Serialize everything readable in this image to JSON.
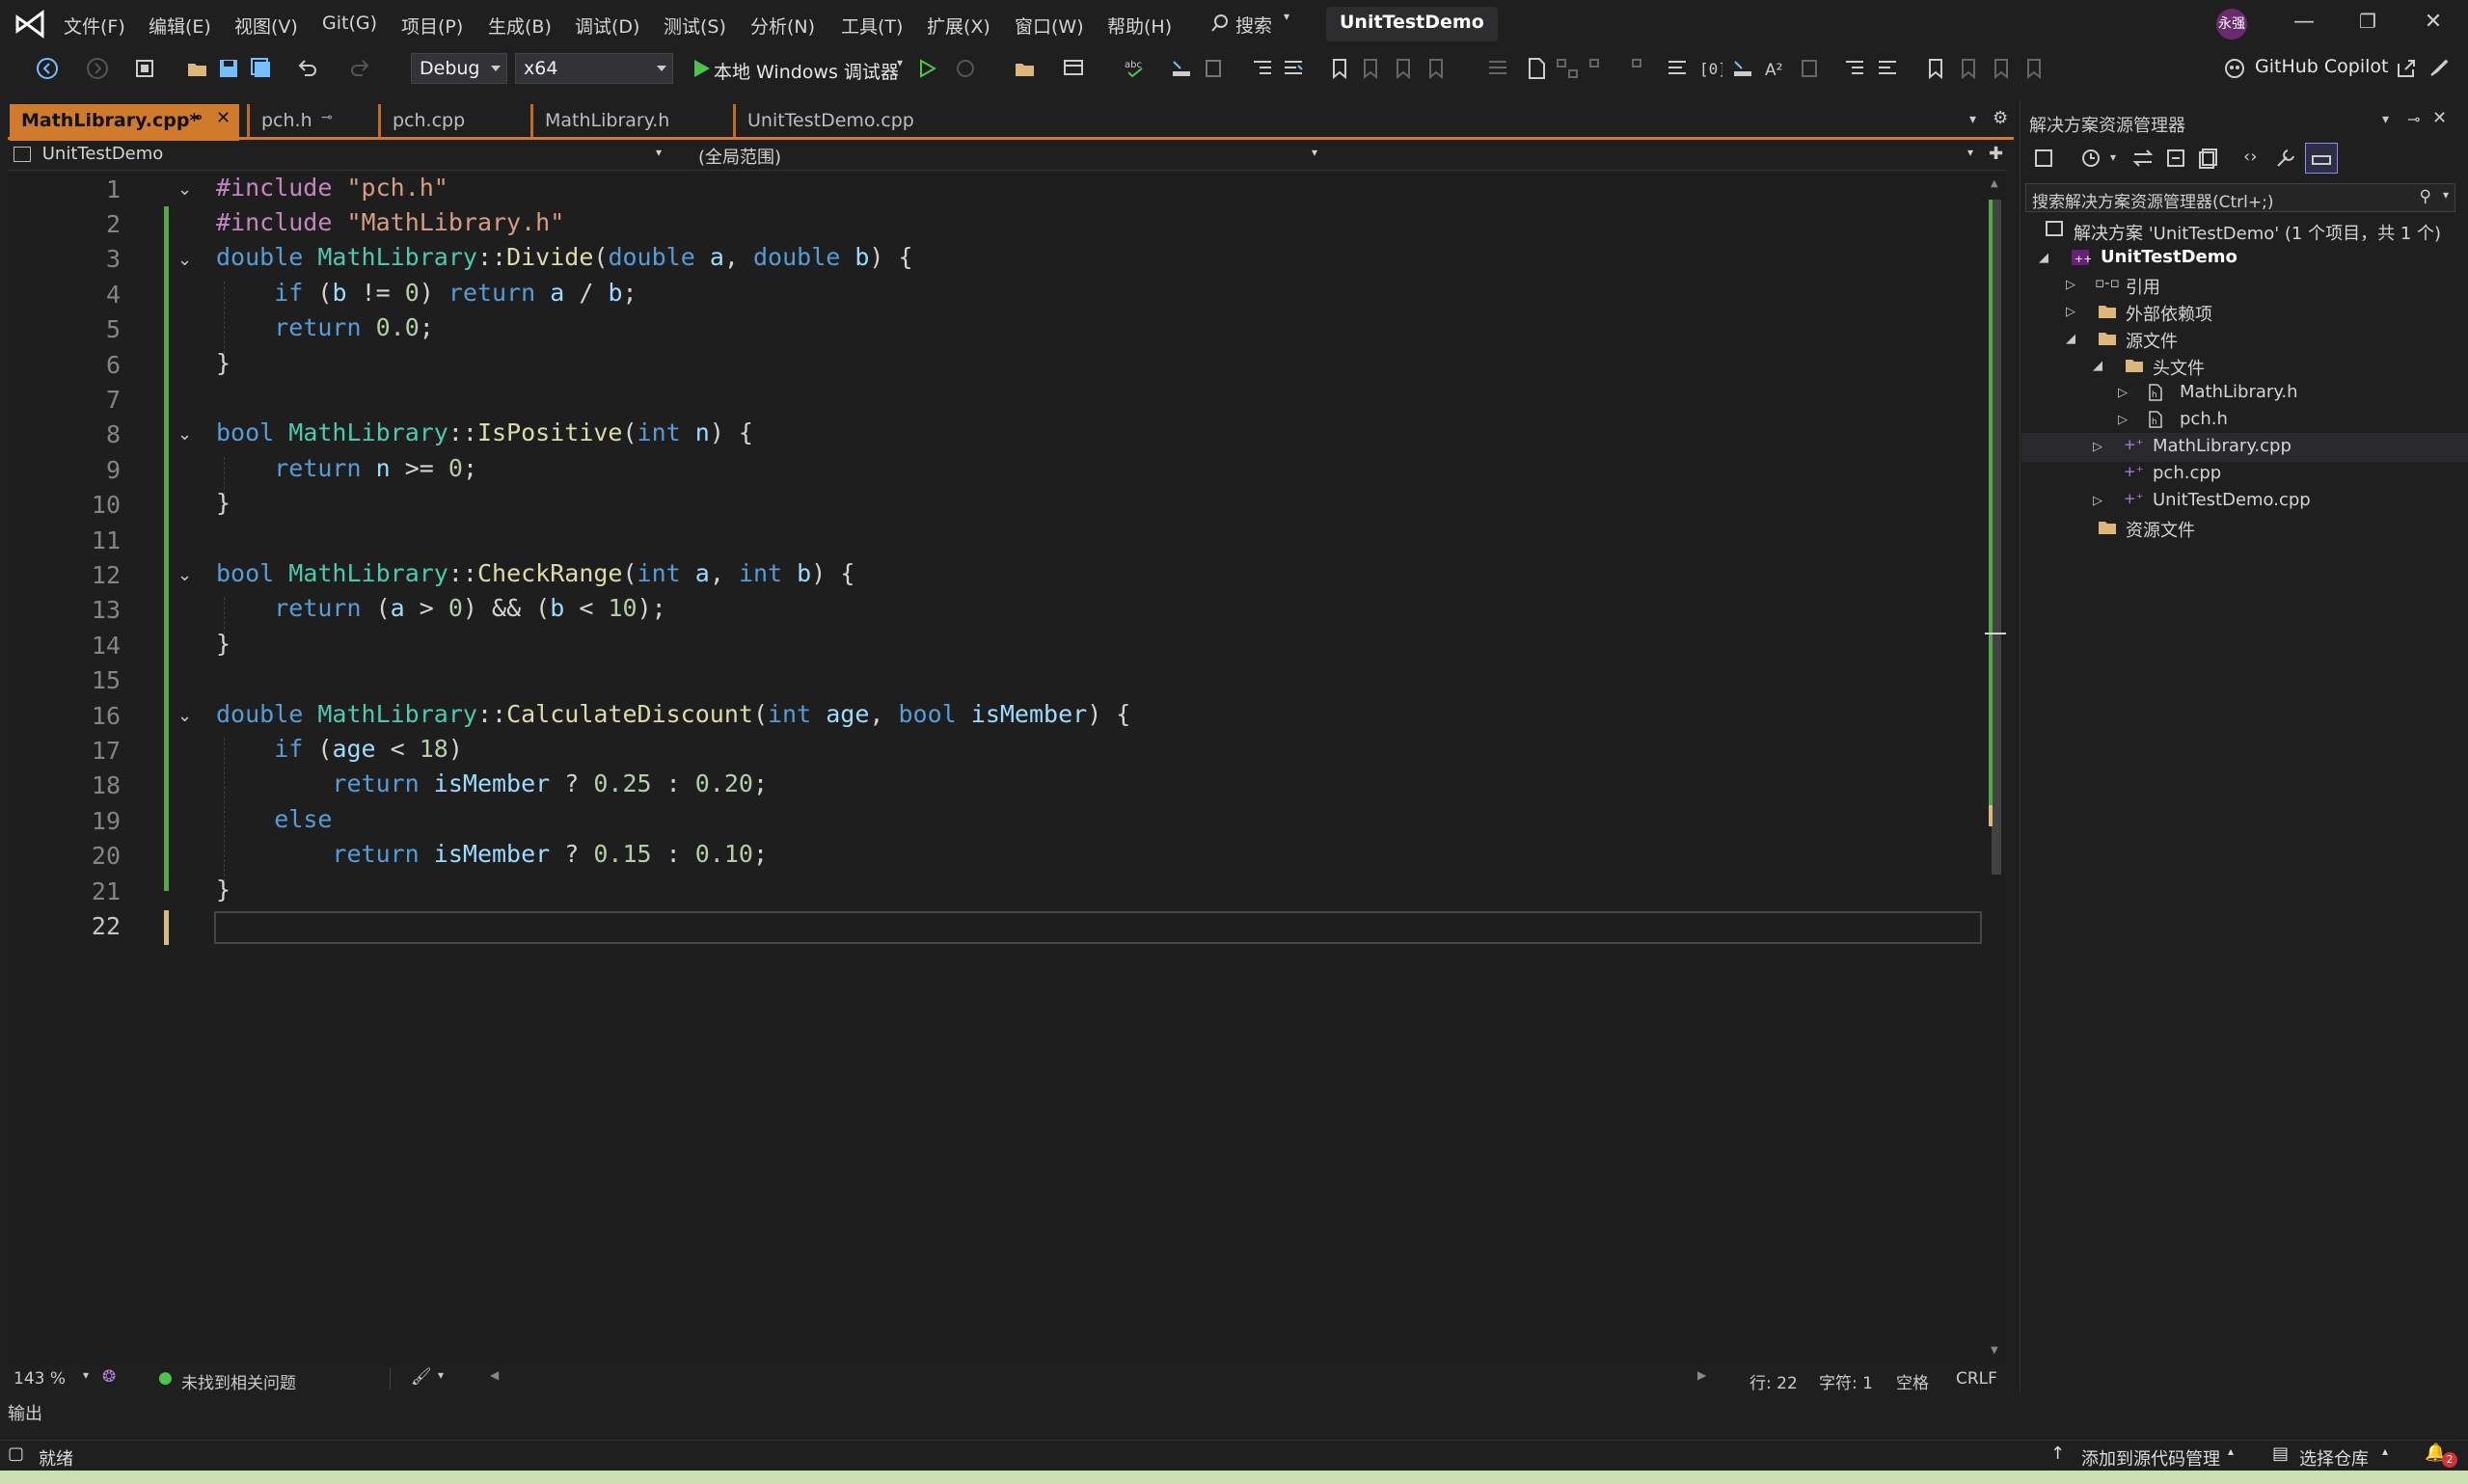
{
  "app": {
    "title": "UnitTestDemo",
    "search_label": "搜索",
    "avatar": "永强"
  },
  "menu": [
    "文件(F)",
    "编辑(E)",
    "视图(V)",
    "Git(G)",
    "项目(P)",
    "生成(B)",
    "调试(D)",
    "测试(S)",
    "分析(N)",
    "工具(T)",
    "扩展(X)",
    "窗口(W)",
    "帮助(H)"
  ],
  "toolbar": {
    "config": "Debug",
    "platform": "x64",
    "run_label": "本地 Windows 调试器",
    "copilot": "GitHub Copilot"
  },
  "tabs": [
    {
      "label": "MathLibrary.cpp*",
      "active": true
    },
    {
      "label": "pch.h",
      "active": false
    },
    {
      "label": "pch.cpp",
      "active": false
    },
    {
      "label": "MathLibrary.h",
      "active": false
    },
    {
      "label": "UnitTestDemo.cpp",
      "active": false
    }
  ],
  "navbar": {
    "project": "UnitTestDemo",
    "scope": "(全局范围)"
  },
  "editor": {
    "line_numbers": [
      "1",
      "2",
      "3",
      "4",
      "5",
      "6",
      "7",
      "8",
      "9",
      "10",
      "11",
      "12",
      "13",
      "14",
      "15",
      "16",
      "17",
      "18",
      "19",
      "20",
      "21",
      "22"
    ],
    "lines": [
      "#include \"pch.h\"",
      "#include \"MathLibrary.h\"",
      "double MathLibrary::Divide(double a, double b) {",
      "    if (b != 0) return a / b;",
      "    return 0.0;",
      "}",
      "",
      "bool MathLibrary::IsPositive(int n) {",
      "    return n >= 0;",
      "}",
      "",
      "bool MathLibrary::CheckRange(int a, int b) {",
      "    return (a > 0) && (b < 10);",
      "}",
      "",
      "double MathLibrary::CalculateDiscount(int age, bool isMember) {",
      "    if (age < 18)",
      "        return isMember ? 0.25 : 0.20;",
      "    else",
      "        return isMember ? 0.15 : 0.10;",
      "}",
      ""
    ],
    "current_line": "22"
  },
  "editor_status": {
    "zoom": "143 %",
    "issues": "未找到相关问题",
    "line": "行: 22",
    "col": "字符: 1",
    "spaces": "空格",
    "eol": "CRLF"
  },
  "output_label": "输出",
  "statusbar": {
    "ready": "就绪",
    "add_source": "添加到源代码管理",
    "select_repo": "选择仓库",
    "notif_count": "2"
  },
  "solution_explorer": {
    "title": "解决方案资源管理器",
    "search_placeholder": "搜索解决方案资源管理器(Ctrl+;)",
    "solution": "解决方案 'UnitTestDemo' (1 个项目，共 1 个)",
    "project": "UnitTestDemo",
    "items": [
      {
        "label": "引用",
        "indent": 2,
        "expander": "closed"
      },
      {
        "label": "外部依赖项",
        "indent": 2,
        "expander": "closed"
      },
      {
        "label": "源文件",
        "indent": 2,
        "expander": "open"
      },
      {
        "label": "头文件",
        "indent": 3,
        "expander": "open"
      },
      {
        "label": "MathLibrary.h",
        "indent": 4,
        "expander": "closed"
      },
      {
        "label": "pch.h",
        "indent": 4,
        "expander": "closed"
      },
      {
        "label": "MathLibrary.cpp",
        "indent": 3,
        "expander": "closed"
      },
      {
        "label": "pch.cpp",
        "indent": 3,
        "expander": "none"
      },
      {
        "label": "UnitTestDemo.cpp",
        "indent": 3,
        "expander": "closed"
      },
      {
        "label": "资源文件",
        "indent": 2,
        "expander": "none"
      }
    ]
  },
  "colors": {
    "accent": "#d07b2c",
    "change_bar": "#57a64a",
    "keyword": "#569cd6",
    "string": "#d69d85",
    "function": "#dcdcaa",
    "type": "#4ec9b0",
    "number": "#b5cea8"
  }
}
